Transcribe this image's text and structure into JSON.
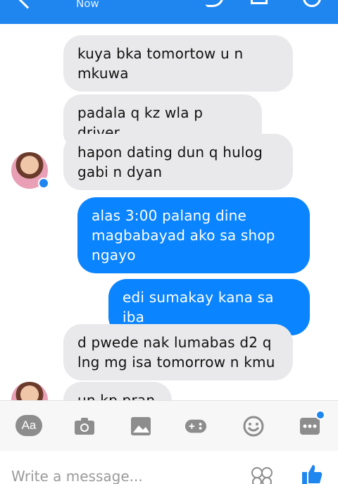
{
  "header": {
    "status": "Now"
  },
  "messages": [
    {
      "side": "in",
      "text": "kuya bka tomortow u n mkuwa"
    },
    {
      "side": "in",
      "text": "padala q kz wla p driver"
    },
    {
      "side": "in",
      "text": "hapon dating dun q hulog gabi n dyan"
    },
    {
      "side": "out",
      "text": "alas 3:00 palang dine magbabayad ako sa shop ngayo"
    },
    {
      "side": "out",
      "text": "edi sumakay kana sa iba"
    },
    {
      "side": "in",
      "text": "d pwede nak lumabas d2 q lng mg isa tomorrow n kmu"
    },
    {
      "side": "in",
      "text": "un kp pran"
    }
  ],
  "toolbar": {
    "aa_label": "Aa"
  },
  "composer": {
    "placeholder": "Write a message..."
  },
  "colors": {
    "accent": "#1f86f0",
    "outgoing_bubble": "#0a84ff",
    "incoming_bubble": "#e9e9eb"
  }
}
